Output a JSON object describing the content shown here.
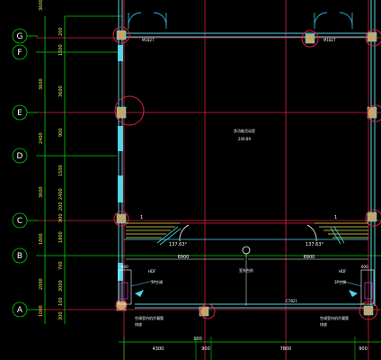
{
  "drawing": {
    "axes": [
      "G",
      "F",
      "E",
      "D",
      "C",
      "B",
      "A"
    ],
    "dims_left_outer": [
      "3600",
      "3600",
      "2400",
      "3600",
      "1800",
      "2000",
      "1000"
    ],
    "dims_left_inner": [
      "200",
      "1500",
      "3600",
      "900",
      "1500",
      "2400",
      "200",
      "900",
      "1800",
      "700",
      "3000",
      "100",
      "300"
    ],
    "door_labels": [
      "M1827",
      "M1827"
    ],
    "room": {
      "name": "多功能活动室",
      "area": "249.89"
    },
    "angles": [
      "137.63°",
      "137.63°"
    ],
    "span_dims": [
      "6900",
      "6900"
    ],
    "center_label": "室外台阶",
    "hdf_labels": [
      "HDF",
      "HDF"
    ],
    "heights": [
      "600",
      "600"
    ],
    "equip_labels": [
      "3P空调",
      "3P空调"
    ],
    "bottom_door": "C7821",
    "bottom_notes": [
      "空调室内机冷凝管",
      "空调室内机冷凝管"
    ],
    "bottom_notes2": [
      "排放",
      "排放"
    ],
    "bottom_dims": [
      "4300",
      "100",
      "900",
      "7800",
      "900"
    ],
    "small_tags": [
      "1",
      "1"
    ]
  },
  "colors": {
    "background": "#000000",
    "axis_line": "#00d000",
    "grid_red": "#e0203a",
    "wall_cyan": "#4fd6e6",
    "dim_yellow": "#e8e84a",
    "column_fill": "#c9a46a",
    "door_cyan": "#2fb6d8"
  }
}
